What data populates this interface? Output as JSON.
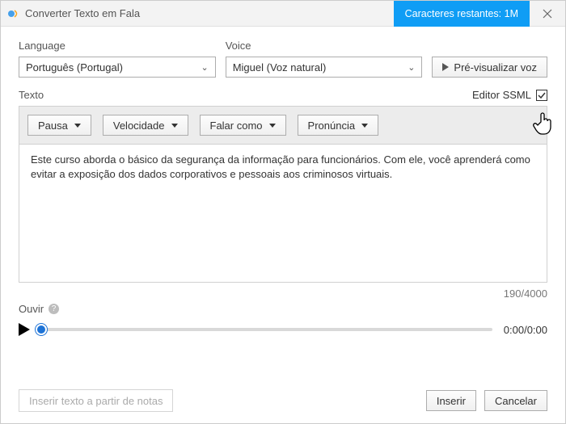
{
  "window": {
    "title": "Converter Texto em Fala"
  },
  "header": {
    "chars_remaining": "Caracteres restantes: 1M"
  },
  "labels": {
    "language": "Language",
    "voice": "Voice",
    "texto": "Texto",
    "ouvir": "Ouvir"
  },
  "selects": {
    "language_value": "Português (Portugal)",
    "voice_value": "Miguel (Voz natural)"
  },
  "buttons": {
    "preview": "Pré-visualizar voz",
    "insert_notes": "Inserir texto a partir de notas",
    "insert": "Inserir",
    "cancel": "Cancelar"
  },
  "ssml": {
    "label": "Editor SSML",
    "checked": true
  },
  "toolbar": {
    "pausa": "Pausa",
    "velocidade": "Velocidade",
    "falar_como": "Falar como",
    "pronuncia": "Pronúncia"
  },
  "text": {
    "content": "Este curso aborda o básico da segurança da informação para funcionários. Com ele, você aprenderá como evitar a exposição dos dados corporativos e pessoais aos criminosos virtuais.",
    "counter": "190/4000"
  },
  "player": {
    "time": "0:00/0:00"
  }
}
